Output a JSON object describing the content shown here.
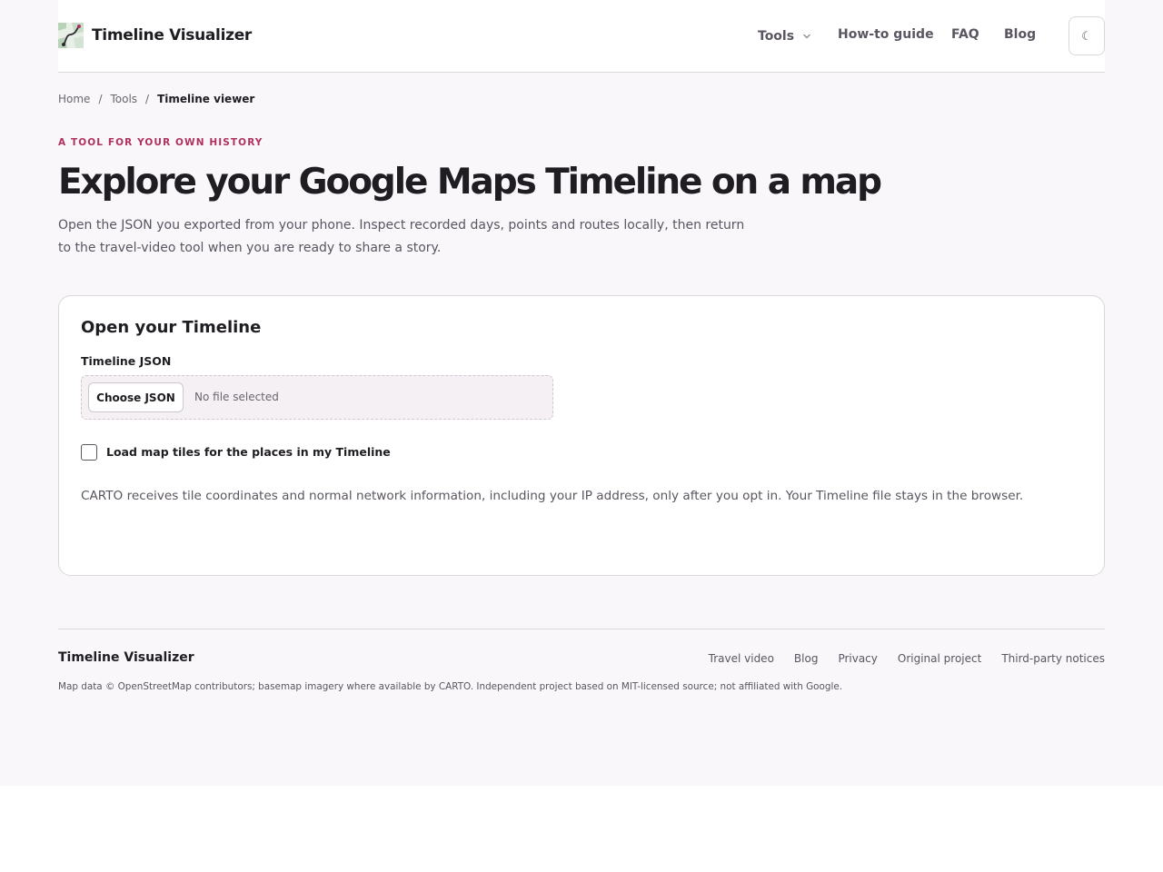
{
  "header": {
    "brand": "Timeline Visualizer",
    "nav": {
      "tools": "Tools",
      "howto": "How-to guide",
      "faq": "FAQ",
      "blog": "Blog"
    },
    "theme_toggle": "☾"
  },
  "breadcrumb": {
    "items": [
      "Home",
      "Tools",
      "Timeline viewer"
    ],
    "separator": "/"
  },
  "hero": {
    "eyebrow": "A TOOL FOR YOUR OWN HISTORY",
    "title": "Explore your Google Maps Timeline on a map",
    "lead": "Open the JSON you exported from your phone. Inspect recorded days, points and routes locally, then return to the travel-video tool when you are ready to share a story."
  },
  "card": {
    "title": "Open your Timeline",
    "field_label": "Timeline JSON",
    "choose_button": "Choose JSON",
    "file_status": "No file selected",
    "checkbox_label": "Load map tiles for the places in my Timeline",
    "checkbox_checked": false,
    "privacy_note": "CARTO receives tile coordinates and normal network information, including your IP address, only after you opt in. Your Timeline file stays in the browser."
  },
  "footer": {
    "brand": "Timeline Visualizer",
    "links": [
      "Travel video",
      "Blog",
      "Privacy",
      "Original project",
      "Third-party notices"
    ],
    "note": "Map data © OpenStreetMap contributors; basemap imagery where available by CARTO. Independent project based on MIT-licensed source; not affiliated with Google."
  },
  "colors": {
    "accent": "#b0305e",
    "background": "#f9f7fa",
    "text": "#1f1c22",
    "muted": "#5a5560"
  }
}
